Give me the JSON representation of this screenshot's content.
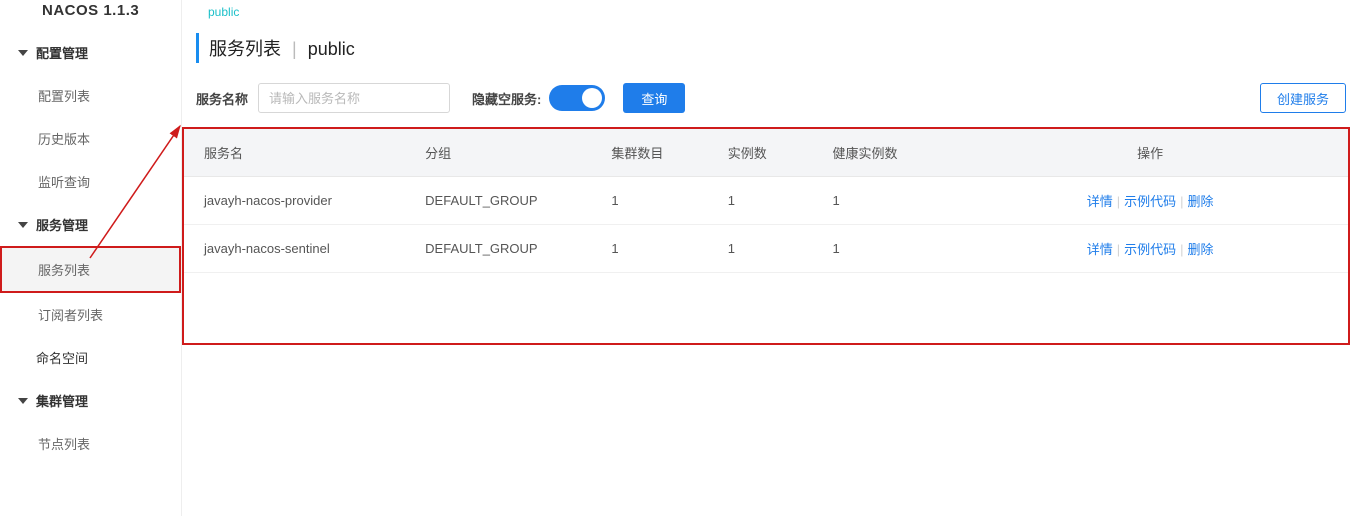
{
  "app": {
    "name": "NACOS",
    "version": "1.1.3"
  },
  "namespace_tab": "public",
  "sidebar": {
    "groups": [
      {
        "label": "配置管理",
        "items": [
          {
            "label": "配置列表"
          },
          {
            "label": "历史版本"
          },
          {
            "label": "监听查询"
          }
        ]
      },
      {
        "label": "服务管理",
        "items": [
          {
            "label": "服务列表",
            "active": true
          },
          {
            "label": "订阅者列表"
          }
        ]
      },
      {
        "label": "命名空间",
        "items": []
      },
      {
        "label": "集群管理",
        "items": [
          {
            "label": "节点列表"
          }
        ]
      }
    ]
  },
  "page": {
    "title": "服务列表",
    "namespace": "public"
  },
  "filters": {
    "name_label": "服务名称",
    "name_placeholder": "请输入服务名称",
    "hide_empty_label": "隐藏空服务:",
    "hide_empty_on": true,
    "query_label": "查询",
    "create_label": "创建服务"
  },
  "table": {
    "columns": {
      "service": "服务名",
      "group": "分组",
      "clusters": "集群数目",
      "instances": "实例数",
      "healthy": "健康实例数",
      "actions": "操作"
    },
    "action_labels": {
      "detail": "详情",
      "sample": "示例代码",
      "delete": "删除"
    },
    "rows": [
      {
        "service": "javayh-nacos-provider",
        "group": "DEFAULT_GROUP",
        "clusters": "1",
        "instances": "1",
        "healthy": "1"
      },
      {
        "service": "javayh-nacos-sentinel",
        "group": "DEFAULT_GROUP",
        "clusters": "1",
        "instances": "1",
        "healthy": "1"
      }
    ]
  }
}
